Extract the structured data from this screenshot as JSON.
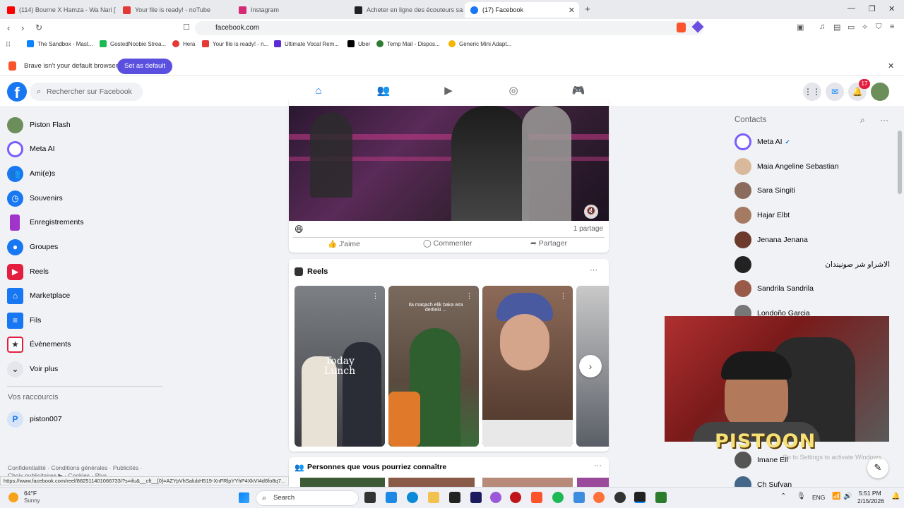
{
  "browser": {
    "tabs": [
      {
        "label": "(114) Bourne X Hamza - Wa Nari [Vid",
        "color": "#ff0000"
      },
      {
        "label": "Your file is ready! - noTube",
        "color": "#e53935"
      },
      {
        "label": "Instagram",
        "color": "#d62976"
      },
      {
        "label": "Acheter en ligne des écouteurs sans f",
        "color": "#222222"
      },
      {
        "label": "(17) Facebook",
        "color": "#1877f2"
      }
    ],
    "new_tab": "+",
    "url": "facebook.com",
    "bookmarks": [
      {
        "label": "The Sandbox - Mast...",
        "color": "#0a84ff"
      },
      {
        "label": "GostedNoobie Strea...",
        "color": "#1db954"
      },
      {
        "label": "Hera",
        "color": "#e53935"
      },
      {
        "label": "Your file is ready! - n...",
        "color": "#e53935"
      },
      {
        "label": "Ultimate Vocal Rem...",
        "color": "#5b2bd6"
      },
      {
        "label": "Uber",
        "color": "#000000"
      },
      {
        "label": "Temp Mail - Dispos...",
        "color": "#2e7d32"
      },
      {
        "label": "Generic Mini Adapt...",
        "color": "#f4b400"
      }
    ],
    "default_banner": {
      "text": "Brave isn't your default browser",
      "button": "Set as default"
    },
    "status_url": "https://www.facebook.com/reel/882511401066733/?s=ifu&__cft__[0]=AZYpVhSalubH519-XnFRlpYYhP4XkVI4d6fo8q7..."
  },
  "facebook": {
    "search_placeholder": "Rechercher sur Facebook",
    "notification_count": "17",
    "left_nav": [
      {
        "label": "Piston Flash",
        "icon": "profile-avatar",
        "color": "#6b8e5a"
      },
      {
        "label": "Meta AI",
        "icon": "meta-ai-icon",
        "color": "#7b5cff"
      },
      {
        "label": "Ami(e)s",
        "icon": "friends-icon",
        "color": "#1877f2"
      },
      {
        "label": "Souvenirs",
        "icon": "memories-icon",
        "color": "#1877f2"
      },
      {
        "label": "Enregistrements",
        "icon": "bookmark-icon",
        "color": "#a033c9"
      },
      {
        "label": "Groupes",
        "icon": "groups-icon",
        "color": "#1877f2"
      },
      {
        "label": "Reels",
        "icon": "reels-icon",
        "color": "#e41e3f"
      },
      {
        "label": "Marketplace",
        "icon": "marketplace-icon",
        "color": "#1877f2"
      },
      {
        "label": "Fils",
        "icon": "feeds-icon",
        "color": "#1877f2"
      },
      {
        "label": "Évènements",
        "icon": "events-icon",
        "color": "#e41e3f"
      },
      {
        "label": "Voir plus",
        "icon": "chevron-down-icon",
        "color": "#e4e6eb"
      }
    ],
    "shortcuts_title": "Vos raccourcis",
    "shortcut": {
      "label": "piston007",
      "initial": "P"
    },
    "footer": "Confidentialité · Conditions générales · Publicités ·",
    "footer2": "Choix publicitaires ▶ · Cookies · Plus",
    "post": {
      "shares": "1 partage",
      "reaction": "😆",
      "like": "J'aime",
      "comment": "Commenter",
      "share": "Partager"
    },
    "reels": {
      "title": "Reels",
      "more": "···",
      "items": [
        {
          "caption": "Today Lunch",
          "colors": [
            "#7d8085",
            "#3b3d42"
          ]
        },
        {
          "caption": "Ila maqach elik baka wra dertleki ...",
          "colors": [
            "#7a6a5e",
            "#3a6a3a"
          ]
        },
        {
          "caption": "",
          "colors": [
            "#8d6a58",
            "#4a3428"
          ]
        },
        {
          "caption": "",
          "colors": [
            "#c9c9c9",
            "#5a5e66"
          ]
        }
      ]
    },
    "people": {
      "title": "Personnes que vous pourriez connaître",
      "more": "···"
    },
    "contacts": {
      "title": "Contacts",
      "list": [
        {
          "name": "Meta AI",
          "color": "#7b5cff",
          "verified": "✔"
        },
        {
          "name": "Maia Angeline Sebastian",
          "color": "#d9b99b"
        },
        {
          "name": "Sara Singiti",
          "color": "#8a6b5c"
        },
        {
          "name": "Hajar Elbt",
          "color": "#a57a63"
        },
        {
          "name": "Jenana Jenana",
          "color": "#6d3b2e"
        },
        {
          "name": "الاشراو شر صونيندان",
          "color": "#222222"
        },
        {
          "name": "Sandrila Sandrila",
          "color": "#9a5a48"
        },
        {
          "name": "Londoño Garcia",
          "color": "#777777"
        },
        {
          "name": "Imane Ell",
          "color": "#555555"
        },
        {
          "name": "Ch Sufyan",
          "color": "#446688"
        }
      ]
    }
  },
  "overlay": {
    "streamer_name": "PISTOON",
    "activate": "Go to Settings to activate Windows."
  },
  "taskbar": {
    "weather_temp": "64°F",
    "weather_desc": "Sunny",
    "search": "Search",
    "lang": "ENG",
    "time": "5:51 PM",
    "date": "2/15/2026"
  }
}
